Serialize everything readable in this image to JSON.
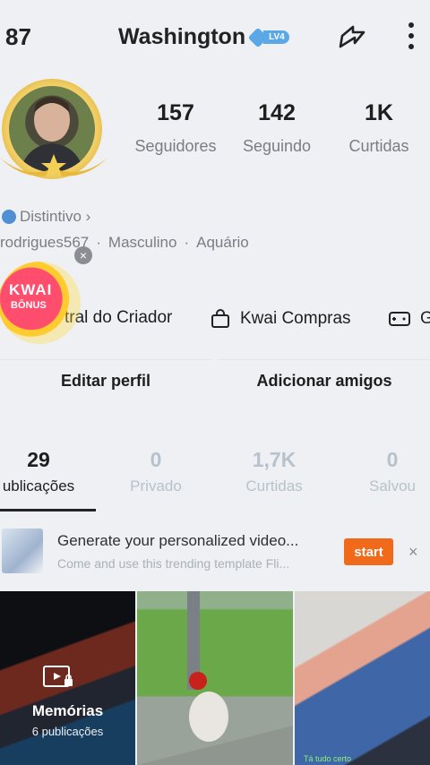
{
  "header": {
    "left_text": "87",
    "title": "Washington",
    "level_badge": "LV4",
    "icons": [
      "share-icon",
      "more-icon"
    ]
  },
  "stats": [
    {
      "num": "157",
      "label": "Seguidores"
    },
    {
      "num": "142",
      "label": "Seguindo"
    },
    {
      "num": "1K",
      "label": "Curtidas"
    }
  ],
  "profile": {
    "badge_label": "Distintivo ›",
    "username": "rodrigues567",
    "gender": "Masculino",
    "sign": "Aquário",
    "separator": "·"
  },
  "kwai_bonus": {
    "line1": "KWAI",
    "line2": "BÔNUS",
    "close": "×"
  },
  "tools": [
    {
      "label": "tral do Criador",
      "icon": "creator-icon"
    },
    {
      "label": "Kwai Compras",
      "icon": "shopping-bag-icon"
    },
    {
      "label": "G",
      "icon": "gamepad-icon"
    }
  ],
  "buttons": {
    "edit": "Editar perfil",
    "add_friends": "Adicionar amigos"
  },
  "tabs": [
    {
      "num": "29",
      "label": "ublicações",
      "active": true
    },
    {
      "num": "0",
      "label": "Privado",
      "active": false
    },
    {
      "num": "1,7K",
      "label": "Curtidas",
      "active": false
    },
    {
      "num": "0",
      "label": "Salvou",
      "active": false
    }
  ],
  "promo": {
    "title": "Generate your personalized video...",
    "subtitle": "Come and use this trending template Fli...",
    "button": "start",
    "close": "×"
  },
  "grid": {
    "memories_title": "Memórias",
    "memories_sub": "6 publicações",
    "caption3": "Tá tudo certo"
  },
  "colors": {
    "accent_orange": "#f06a1a",
    "level_blue": "#5aa9e6",
    "inactive_tab": "#b7c2cc"
  }
}
